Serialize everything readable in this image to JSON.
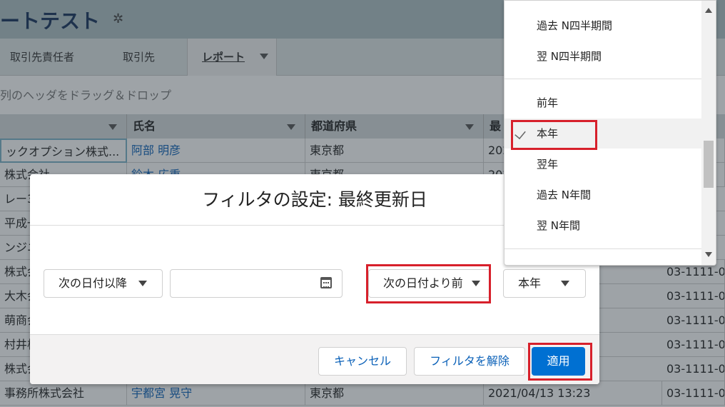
{
  "page": {
    "title": "ートテスト",
    "gear_icon": "gear-icon"
  },
  "tabs": [
    {
      "label": "取引先責任者"
    },
    {
      "label": "取引先"
    },
    {
      "label": "レポート"
    }
  ],
  "grouping_hint": "列のヘッダをドラッグ＆ドロップ",
  "grid": {
    "headers": [
      "",
      "氏名",
      "都道府県",
      "最"
    ],
    "rows": [
      [
        "ックオプション株式...",
        "阿部 明彦",
        "東京都",
        "202",
        ""
      ],
      [
        "株式会社",
        "鈴木 広重",
        "東京都",
        "202",
        ""
      ],
      [
        "レー3",
        "",
        "",
        "",
        ""
      ],
      [
        "平成一",
        "",
        "",
        "",
        ""
      ],
      [
        "ンジニ",
        "",
        "",
        "",
        ""
      ],
      [
        "株式会",
        "",
        "",
        "",
        "03-1111-00"
      ],
      [
        "大木会",
        "",
        "",
        "",
        "03-1111-00"
      ],
      [
        "萌商会",
        "",
        "",
        "",
        "03-1111-00"
      ],
      [
        "村井株",
        "",
        "",
        "",
        "03-1111-00"
      ],
      [
        "株式会",
        "",
        "",
        "",
        "03-1111-00"
      ],
      [
        "事務所株式会社",
        "宇都宮 晃守",
        "東京都",
        "2021/04/13 13:23",
        "03-1111-00"
      ]
    ]
  },
  "modal": {
    "title": "フィルタの設定: 最終更新日",
    "operator_start": "次の日付以降",
    "date_input_value": "",
    "operator_end": "次の日付より前",
    "end_value": "本年",
    "cancel_label": "キャンセル",
    "clear_label": "フィルタを解除",
    "apply_label": "適用"
  },
  "dropdown": {
    "items": [
      {
        "label": "過去 N四半期間",
        "checked": false
      },
      {
        "label": "翌 N四半期間",
        "checked": false
      },
      {
        "label": "前年",
        "checked": false
      },
      {
        "label": "本年",
        "checked": true
      },
      {
        "label": "翌年",
        "checked": false
      },
      {
        "label": "過去 N年間",
        "checked": false
      },
      {
        "label": "翌 N年間",
        "checked": false
      }
    ]
  },
  "colors": {
    "highlight": "#d7202b",
    "primary": "#0070d2",
    "link": "#0b61b8"
  }
}
